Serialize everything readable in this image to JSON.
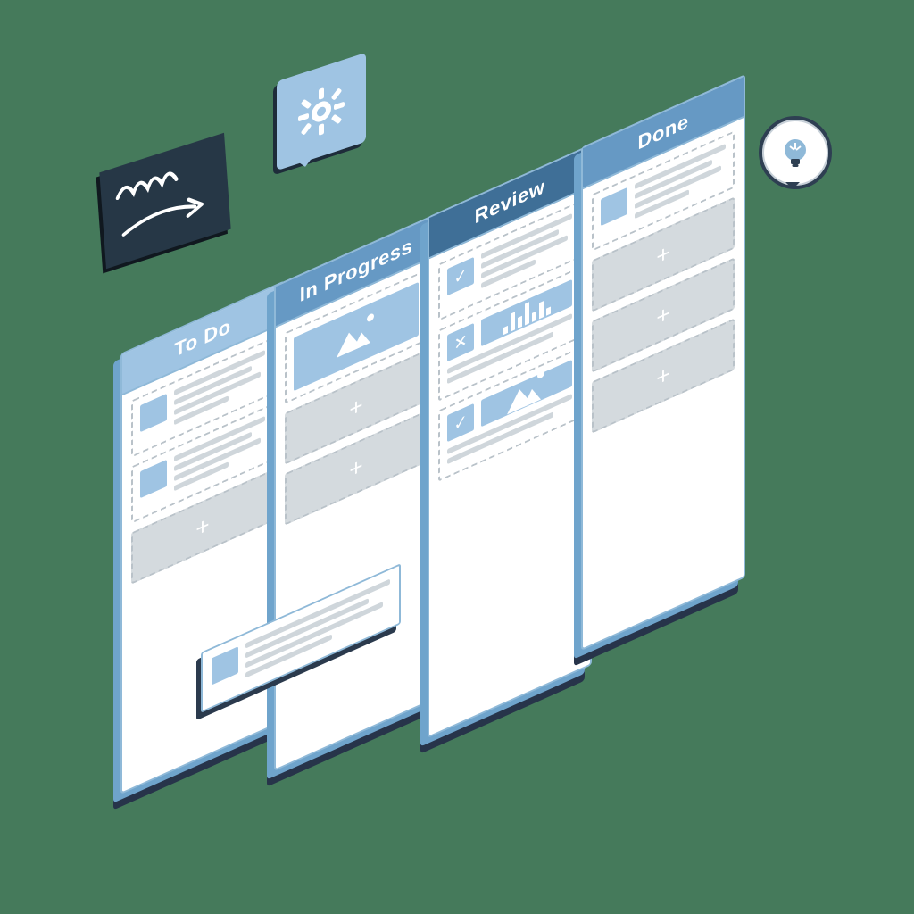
{
  "board": {
    "columns": [
      {
        "id": "todo",
        "title": "To Do",
        "header_style": "hdr-light"
      },
      {
        "id": "in_progress",
        "title": "In Progress",
        "header_style": "hdr-mid"
      },
      {
        "id": "review",
        "title": "Review",
        "header_style": "hdr-dark"
      },
      {
        "id": "done",
        "title": "Done",
        "header_style": "hdr-mid"
      }
    ],
    "add_placeholder_glyph": "+"
  },
  "decorations": {
    "sticky_note_icon": "signature-arrow",
    "gear_icon": "gear",
    "idea_icon": "lightbulb"
  },
  "card_status_icons": {
    "approved": "✓",
    "rejected": "✕"
  },
  "colors": {
    "page_bg": "#457a5b",
    "panel_bg": "#ffffff",
    "panel_border": "#8fb9d8",
    "panel_side": "#6fa4cc",
    "panel_shadow": "#27344a",
    "header_light": "#9fc4e3",
    "header_mid": "#6699c4",
    "header_dark": "#3f6f97",
    "placeholder_bg": "#d4dade",
    "line": "#cfd6db",
    "note_bg": "#263746"
  }
}
